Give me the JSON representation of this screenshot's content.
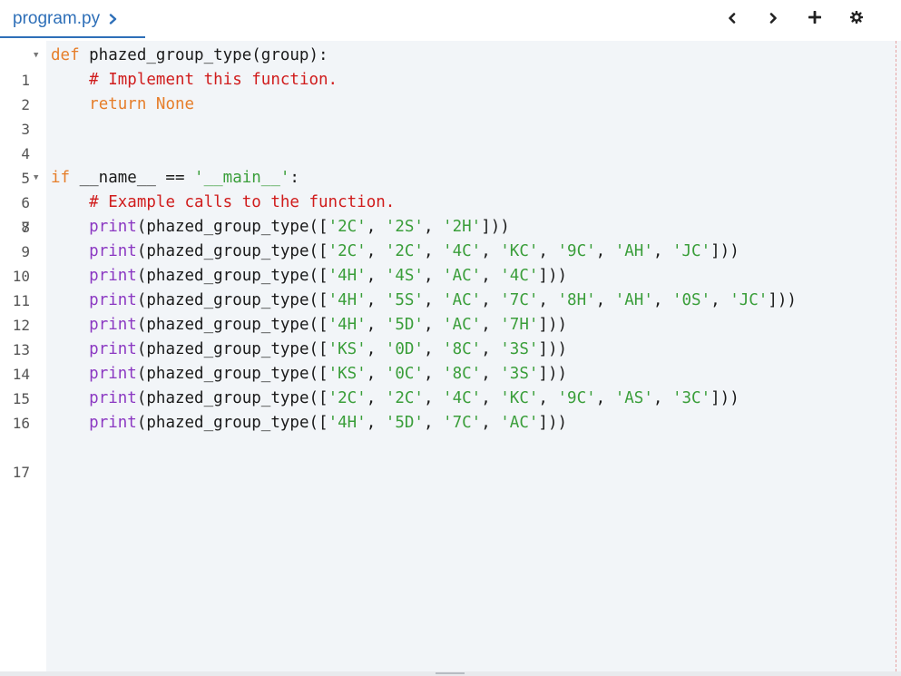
{
  "file_tab": {
    "name": "program.py"
  },
  "toolbar": {
    "icons": [
      "chevron-left-icon",
      "chevron-right-icon",
      "plus-icon",
      "gear-icon"
    ]
  },
  "colors": {
    "accent": "#2e6fb8",
    "keyword": "#e67e2a",
    "comment": "#d01c1c",
    "builtin": "#8b38c2",
    "string": "#3a9e3a",
    "editor_bg": "#f2f5f8"
  },
  "editor": {
    "line_numbers": [
      "1",
      "2",
      "3",
      "4",
      "5",
      "6",
      "7",
      "8",
      "9",
      "10",
      "11",
      "12",
      "13",
      "14",
      "15",
      "16",
      "17"
    ],
    "lines": {
      "l1": {
        "kw": "def",
        "rest": " phazed_group_type(group):"
      },
      "l2": {
        "indent": "    ",
        "cm": "# Implement this function."
      },
      "l3": {
        "indent": "    ",
        "kw": "return None"
      },
      "l6": {
        "kw": "if",
        "mid": " __name__ == ",
        "str": "'__main__'",
        "end": ":"
      },
      "l7": {
        "indent": "    ",
        "cm": "# Example calls to the function."
      },
      "calls": [
        {
          "fn": "print",
          "pre": "(phazed_group_type([",
          "args": [
            "'2C'",
            "'2S'",
            "'2H'"
          ],
          "post": "]))"
        },
        {
          "fn": "print",
          "pre": "(phazed_group_type([",
          "args": [
            "'2C'",
            "'2C'",
            "'4C'",
            "'KC'",
            "'9C'",
            "'AH'",
            "'JC'"
          ],
          "post": "]))"
        },
        {
          "fn": "print",
          "pre": "(phazed_group_type([",
          "args": [
            "'4H'",
            "'4S'",
            "'AC'",
            "'4C'"
          ],
          "post": "]))"
        },
        {
          "fn": "print",
          "pre": "(phazed_group_type([",
          "args": [
            "'4H'",
            "'5S'",
            "'AC'",
            "'7C'",
            "'8H'",
            "'AH'",
            "'0S'",
            "'JC'"
          ],
          "post": "]))"
        },
        {
          "fn": "print",
          "pre": "(phazed_group_type([",
          "args": [
            "'4H'",
            "'5D'",
            "'AC'",
            "'7H'"
          ],
          "post": "]))"
        },
        {
          "fn": "print",
          "pre": "(phazed_group_type([",
          "args": [
            "'KS'",
            "'0D'",
            "'8C'",
            "'3S'"
          ],
          "post": "]))"
        },
        {
          "fn": "print",
          "pre": "(phazed_group_type([",
          "args": [
            "'KS'",
            "'0C'",
            "'8C'",
            "'3S'"
          ],
          "post": "]))"
        },
        {
          "fn": "print",
          "pre": "(phazed_group_type([",
          "args": [
            "'2C'",
            "'2C'",
            "'4C'",
            "'KC'",
            "'9C'",
            "'AS'",
            "'3C'"
          ],
          "post": "]))"
        },
        {
          "fn": "print",
          "pre": "(phazed_group_type([",
          "args": [
            "'4H'",
            "'5D'",
            "'7C'",
            "'AC'"
          ],
          "post": "]))"
        }
      ]
    }
  }
}
